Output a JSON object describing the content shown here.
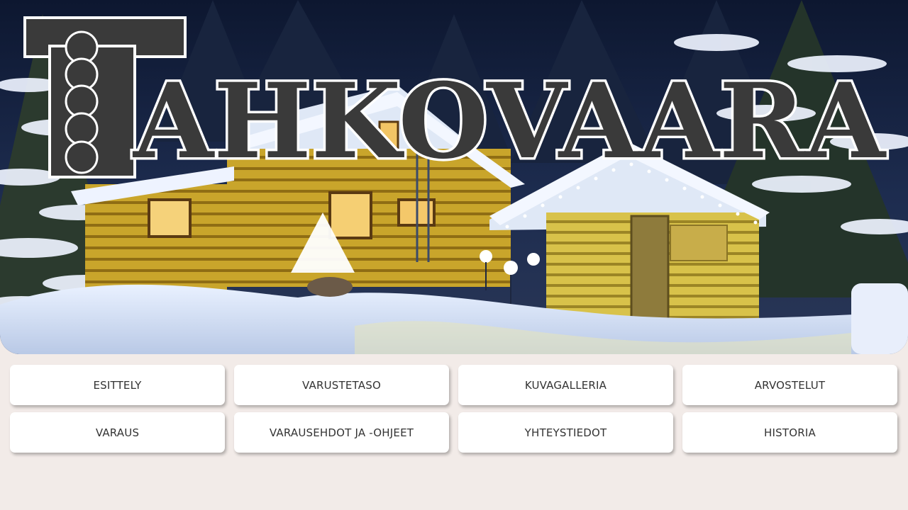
{
  "site": {
    "logo_text": "TAHKOVAARA"
  },
  "nav": {
    "items": [
      {
        "label": "ESITTELY"
      },
      {
        "label": "VARUSTETASO"
      },
      {
        "label": "KUVAGALLERIA"
      },
      {
        "label": "ARVOSTELUT"
      },
      {
        "label": "VARAUS"
      },
      {
        "label": "VARAUSEHDOT JA -OHJEET"
      },
      {
        "label": "YHTEYSTIEDOT"
      },
      {
        "label": "HISTORIA"
      }
    ]
  },
  "colors": {
    "page_background": "#f2ebe8",
    "button_background": "#ffffff",
    "button_text": "#333333",
    "logo_fill": "#3a3a3a",
    "logo_outline": "#ffffff"
  }
}
